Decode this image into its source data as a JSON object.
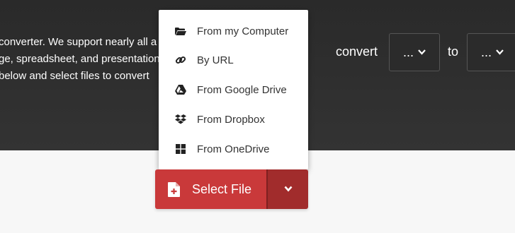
{
  "hero": {
    "intro_lines": [
      "converter. We support nearly all a",
      "ge, spreadsheet, and presentation",
      "below and select files to convert"
    ],
    "convert_label": "convert",
    "from_format": "...",
    "to_label": "to",
    "to_format": "..."
  },
  "upload_menu": {
    "items": [
      {
        "label": "From my Computer",
        "icon": "folder-open-icon"
      },
      {
        "label": "By URL",
        "icon": "link-icon"
      },
      {
        "label": "From Google Drive",
        "icon": "google-drive-icon"
      },
      {
        "label": "From Dropbox",
        "icon": "dropbox-icon"
      },
      {
        "label": "From OneDrive",
        "icon": "windows-icon"
      }
    ]
  },
  "select_button": {
    "label": "Select File",
    "icon": "file-plus-icon",
    "caret_icon": "chevron-down-icon"
  },
  "colors": {
    "hero_bg": "#2f2f2f",
    "button_red": "#c9393a",
    "button_red_dark": "#a12c2c"
  }
}
